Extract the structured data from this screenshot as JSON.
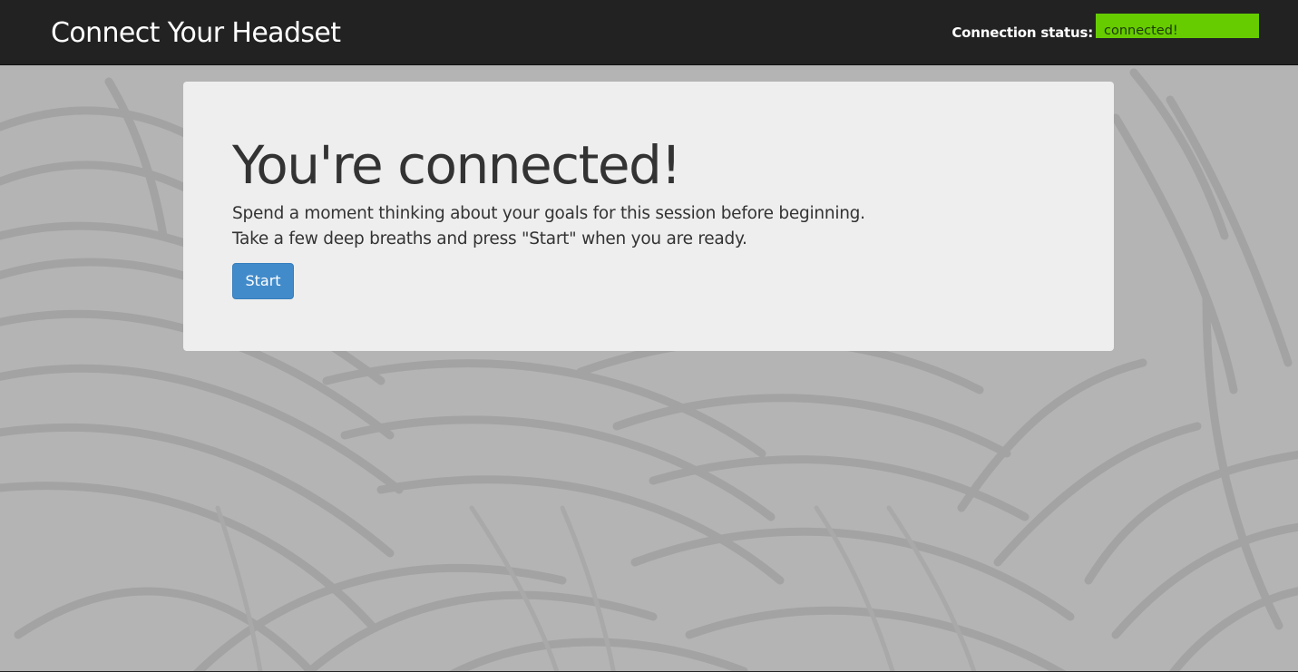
{
  "navbar": {
    "brand": "Connect Your Headset",
    "status_label": "Connection status:",
    "status_value": "connected!",
    "status_color": "#66cc00"
  },
  "panel": {
    "heading": "You're connected!",
    "lines": [
      "Spend a moment thinking about your goals for this session before beginning.",
      "Take a few deep breaths and press \"Start\" when you are ready."
    ],
    "start_label": "Start"
  },
  "colors": {
    "navbar_bg": "#222222",
    "panel_bg": "#eeeeee",
    "page_bg": "#b3b3b3",
    "button_bg": "#428bca"
  },
  "background": {
    "icon": "leaf-pattern-background"
  }
}
